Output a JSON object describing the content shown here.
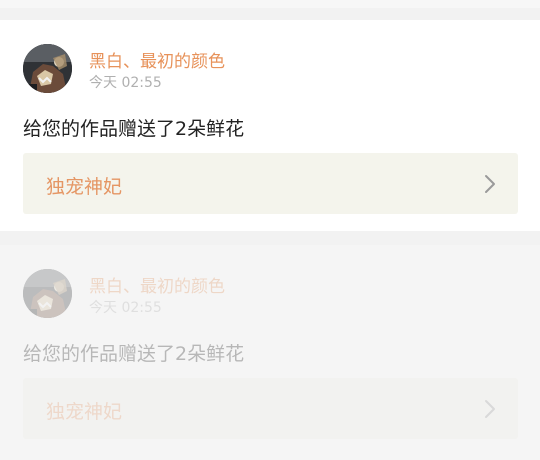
{
  "notifications": [
    {
      "username": "黑白、最初的颜色",
      "timestamp": "今天 02:55",
      "message": "给您的作品赠送了2朵鲜花",
      "work_title": "独宠神妃"
    },
    {
      "username": "黑白、最初的颜色",
      "timestamp": "今天 02:55",
      "message": "给您的作品赠送了2朵鲜花",
      "work_title": "独宠神妃"
    }
  ],
  "colors": {
    "accent": "#e7925a",
    "link_bg": "#f4f4ec",
    "timestamp": "#b0b0b0",
    "message": "#222222"
  },
  "icons": {
    "chevron": "chevron-right-icon"
  }
}
